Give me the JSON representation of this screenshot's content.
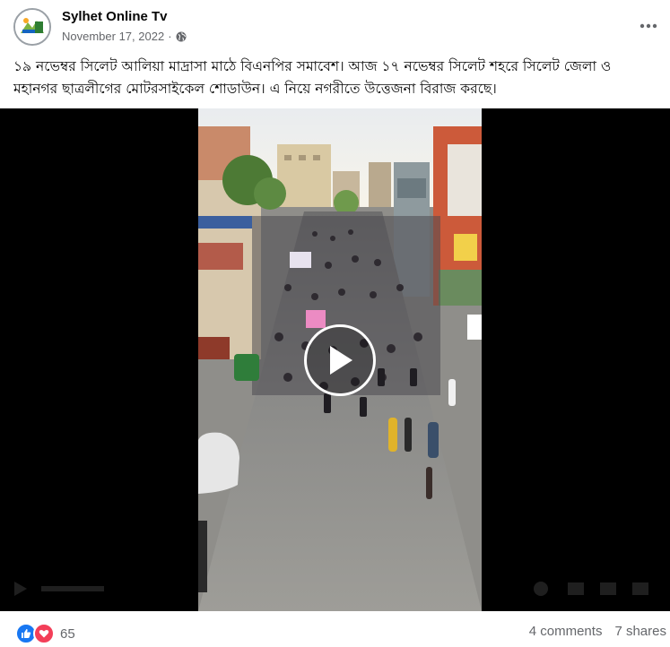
{
  "post": {
    "author": "Sylhet Online Tv",
    "date": "November 17, 2022",
    "separator": "·",
    "audience_icon": "globe-icon",
    "caption": "১৯ নভেম্বর সিলেট আলিয়া মাদ্রাসা মাঠে বিএনপির সমাবেশ। আজ ১৭ নভেম্বর সিলেট শহরে সিলেট জেলা ও মহানগর ছাত্রলীগের মোটরসাইকেল শোডাউন। এ নিয়ে নগরীতে উত্তেজনা বিরাজ করছে।"
  },
  "video": {
    "play_icon": "play-icon",
    "description": "aerial view of a crowded street with a motorcycle procession"
  },
  "footer": {
    "reaction_icons": [
      "like-icon",
      "love-icon"
    ],
    "reaction_count": "65",
    "comments": "4 comments",
    "shares": "7 shares"
  },
  "colors": {
    "like_blue": "#1877f2",
    "love_red": "#f33e58",
    "secondary_text": "#65676b"
  }
}
